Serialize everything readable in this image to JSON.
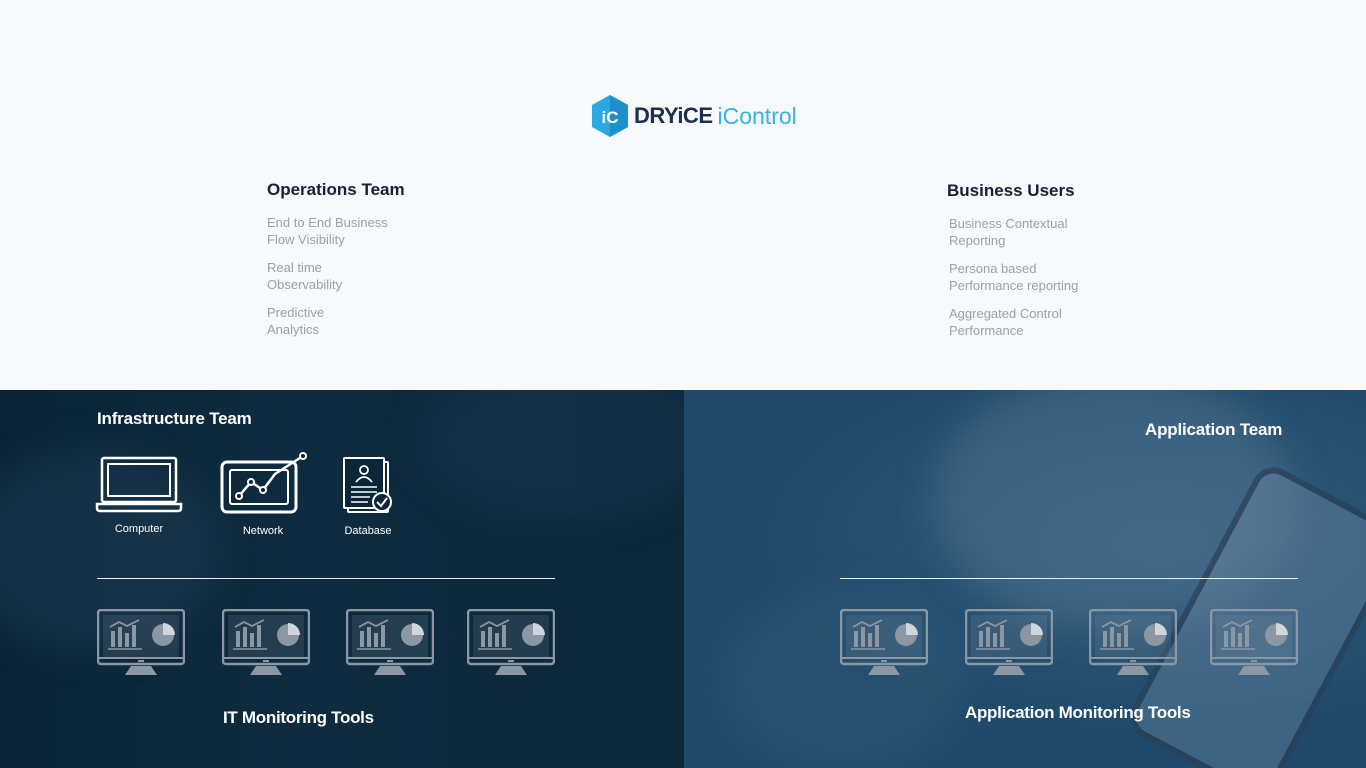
{
  "logo": {
    "mark": "iC",
    "brand": "DRYiCE",
    "product": "iControl"
  },
  "operations": {
    "title": "Operations Team",
    "items": [
      "End to End Business\nFlow Visibility",
      "Real time\nObservability",
      "Predictive\nAnalytics"
    ]
  },
  "business": {
    "title": "Business Users",
    "items": [
      "Business Contextual\nReporting",
      "Persona based\nPerformance reporting",
      "Aggregated Control\nPerformance"
    ]
  },
  "infrastructure": {
    "title": "Infrastructure Team",
    "icons": [
      {
        "label": "Computer",
        "icon": "laptop-icon"
      },
      {
        "label": "Network",
        "icon": "network-chart-icon"
      },
      {
        "label": "Database",
        "icon": "document-check-icon"
      }
    ],
    "tools_title": "IT Monitoring Tools",
    "monitor_icon": "monitor-dashboard-icon"
  },
  "application": {
    "title": "Application Team",
    "tools_title": "Application Monitoring Tools",
    "monitor_icon": "monitor-dashboard-icon"
  },
  "colors": {
    "brand_dark": "#1c2f4c",
    "brand_accent": "#33b3e6",
    "heading": "#142036",
    "muted_text": "#9aa1a9",
    "panel_left": "#0a2638",
    "panel_right": "#1f4a6b",
    "monitor_gray": "#8b97a3"
  }
}
